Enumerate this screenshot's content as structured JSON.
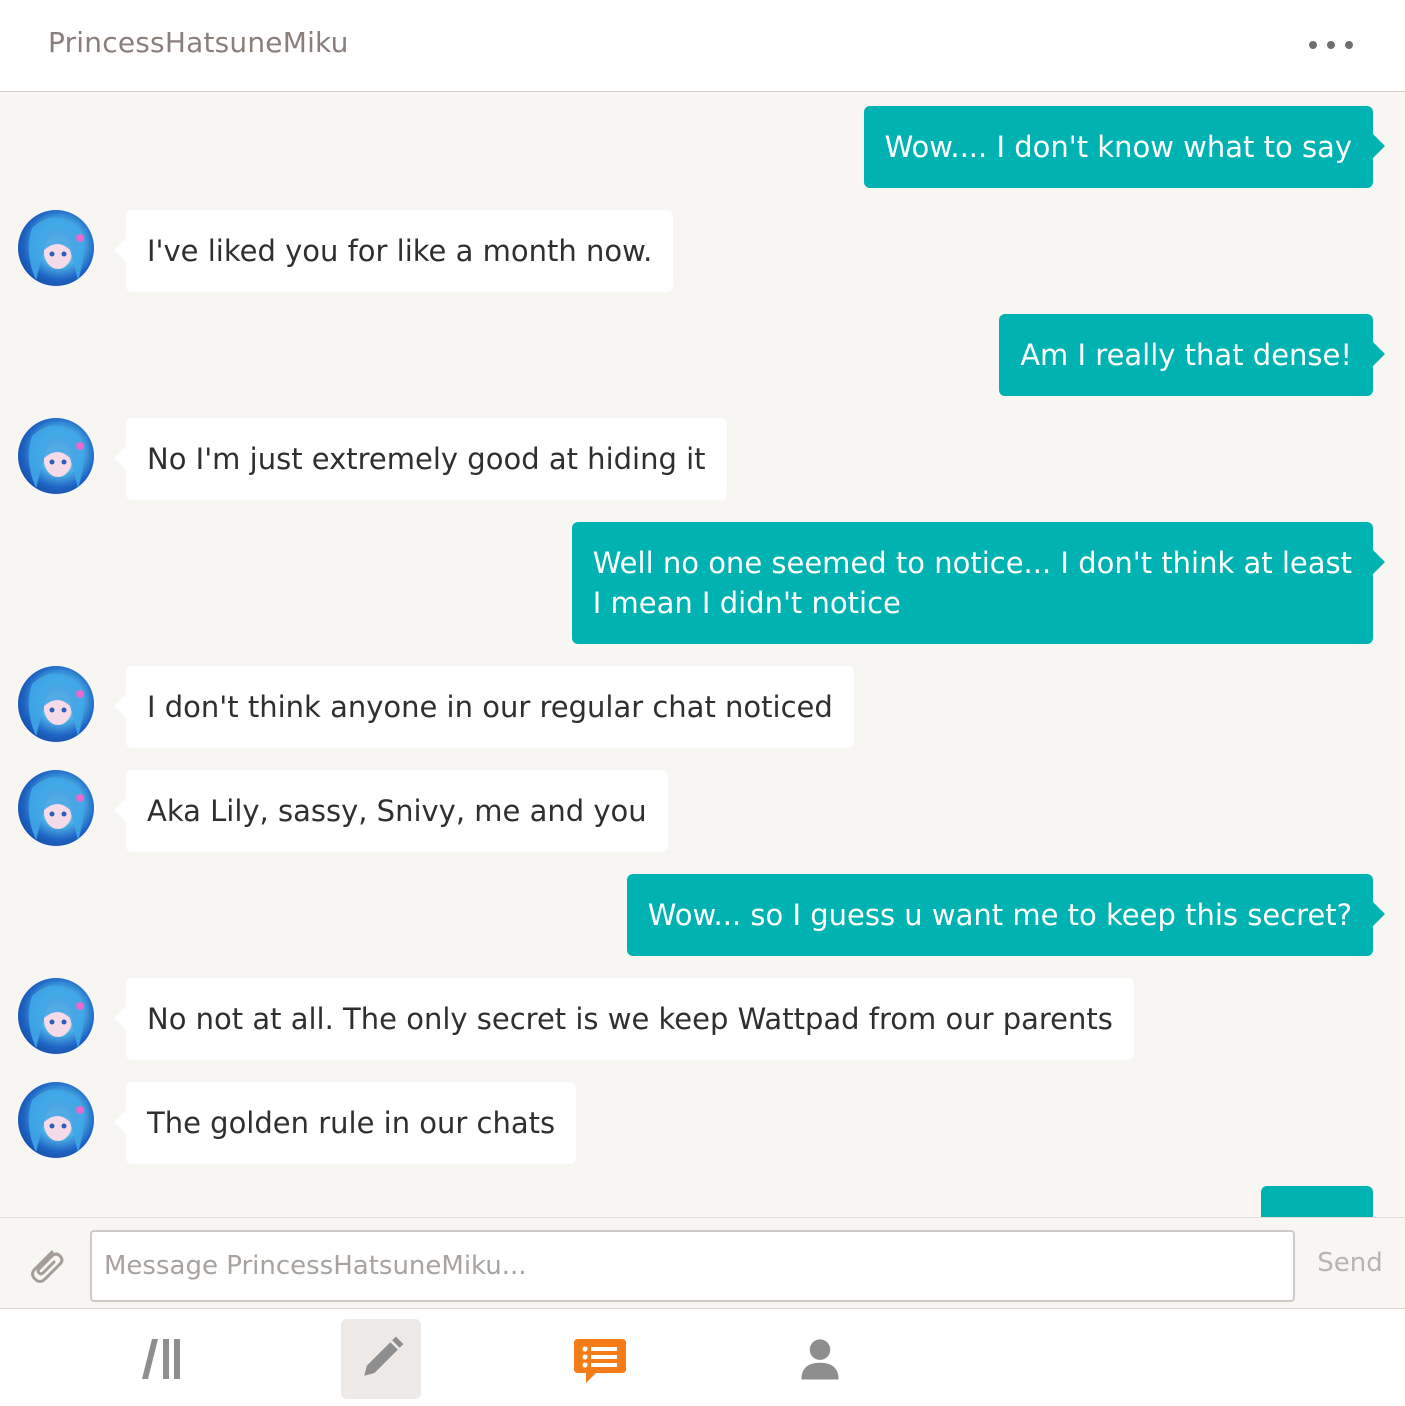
{
  "header": {
    "title": "PrincessHatsuneMiku"
  },
  "messages": [
    {
      "side": "out",
      "text": "Wow.... I don't know what to say"
    },
    {
      "side": "in",
      "text": "I've liked you for like a month now."
    },
    {
      "side": "out",
      "text": "Am I really that dense!"
    },
    {
      "side": "in",
      "text": "No I'm just extremely good at hiding it"
    },
    {
      "side": "out",
      "text": "Well no one seemed to notice... I don't think at least",
      "text2": "I mean I didn't notice"
    },
    {
      "side": "in",
      "text": "I don't think anyone in our regular chat noticed"
    },
    {
      "side": "in",
      "text": "Aka Lily, sassy, Snivy, me and you"
    },
    {
      "side": "out",
      "text": "Wow... so I guess u want me to keep this secret?"
    },
    {
      "side": "in",
      "text": "No not at all. The only secret is we keep Wattpad from our parents"
    },
    {
      "side": "in",
      "text": "The golden rule in our chats"
    }
  ],
  "composer": {
    "placeholder": "Message PrincessHatsuneMiku...",
    "send_label": "Send"
  },
  "nav": {
    "items": [
      {
        "icon": "library-icon"
      },
      {
        "icon": "write-icon"
      },
      {
        "icon": "messages-icon"
      },
      {
        "icon": "profile-icon"
      }
    ]
  },
  "colors": {
    "outgoing_bubble": "#00b2b2",
    "incoming_bubble": "#ffffff",
    "accent_orange": "#f47b16",
    "background": "#f7f6f2"
  }
}
